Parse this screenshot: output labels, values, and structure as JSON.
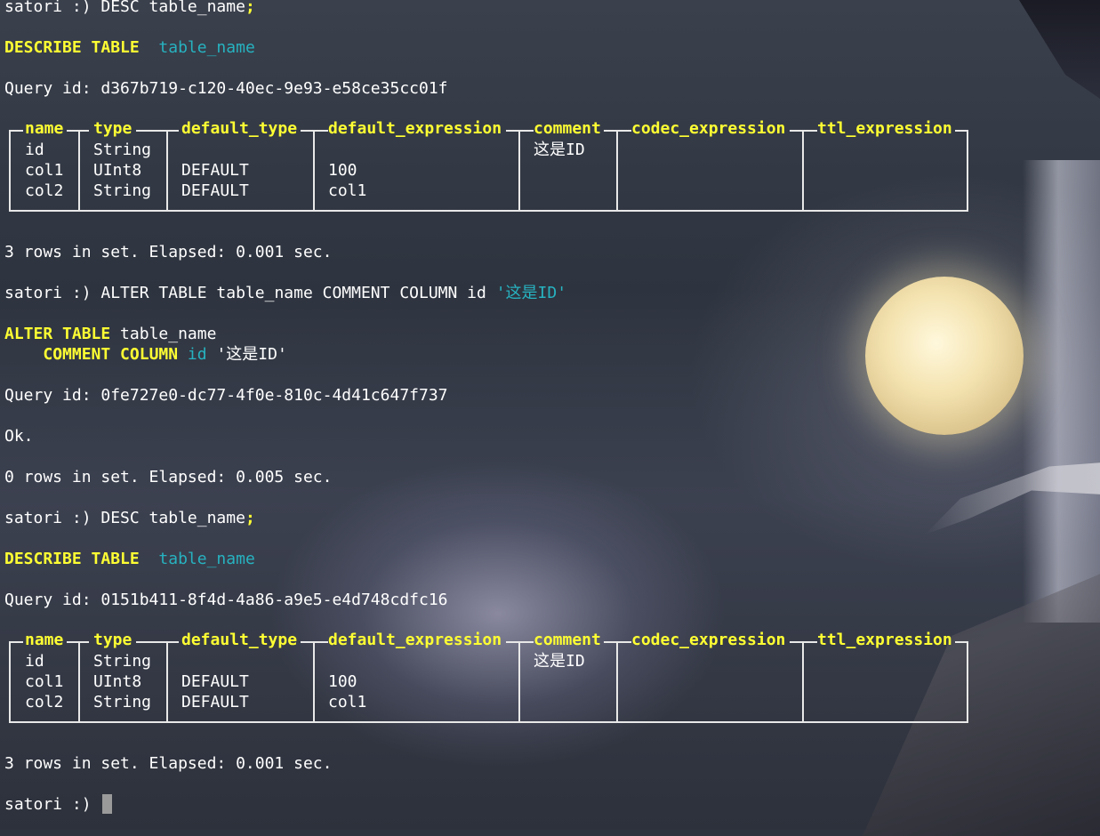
{
  "colors": {
    "keyword": "#ffff33",
    "identifier": "#27b2c0",
    "text": "#ffffff",
    "border": "#e8e8e8",
    "cursor": "#9a9a9a"
  },
  "session": [
    {
      "prompt": "satori :) ",
      "command_main": "DESC table_name",
      "command_terminator": ";",
      "formatted": {
        "keyword": "DESCRIBE TABLE",
        "identifier": "table_name"
      },
      "query_id": "Query id: d367b719-c120-40ec-9e93-e58ce35cc01f",
      "table": {
        "columns": [
          "name",
          "type",
          "default_type",
          "default_expression",
          "comment",
          "codec_expression",
          "ttl_expression"
        ],
        "rows": [
          [
            "id",
            "String",
            "",
            "",
            "这是ID",
            "",
            ""
          ],
          [
            "col1",
            "UInt8",
            "DEFAULT",
            "100",
            "",
            "",
            ""
          ],
          [
            "col2",
            "String",
            "DEFAULT",
            "col1",
            "",
            "",
            ""
          ]
        ]
      },
      "summary": "3 rows in set. Elapsed: 0.001 sec."
    },
    {
      "prompt": "satori :) ",
      "command_main": "ALTER TABLE table_name COMMENT COLUMN id ",
      "command_string": "'这是ID'",
      "formatted_line1": {
        "keyword": "ALTER TABLE",
        "rest": " table_name"
      },
      "formatted_line2": {
        "keyword": "COMMENT COLUMN",
        "identifier": "id",
        "rest": " '这是ID'"
      },
      "query_id": "Query id: 0fe727e0-dc77-4f0e-810c-4d41c647f737",
      "ok": "Ok.",
      "summary": "0 rows in set. Elapsed: 0.005 sec."
    },
    {
      "prompt": "satori :) ",
      "command_main": "DESC table_name",
      "command_terminator": ";",
      "formatted": {
        "keyword": "DESCRIBE TABLE",
        "identifier": "table_name"
      },
      "query_id": "Query id: 0151b411-8f4d-4a86-a9e5-e4d748cdfc16",
      "table": {
        "columns": [
          "name",
          "type",
          "default_type",
          "default_expression",
          "comment",
          "codec_expression",
          "ttl_expression"
        ],
        "rows": [
          [
            "id",
            "String",
            "",
            "",
            "这是ID",
            "",
            ""
          ],
          [
            "col1",
            "UInt8",
            "DEFAULT",
            "100",
            "",
            "",
            ""
          ],
          [
            "col2",
            "String",
            "DEFAULT",
            "col1",
            "",
            "",
            ""
          ]
        ]
      },
      "summary": "3 rows in set. Elapsed: 0.001 sec."
    }
  ],
  "final_prompt": "satori :)"
}
